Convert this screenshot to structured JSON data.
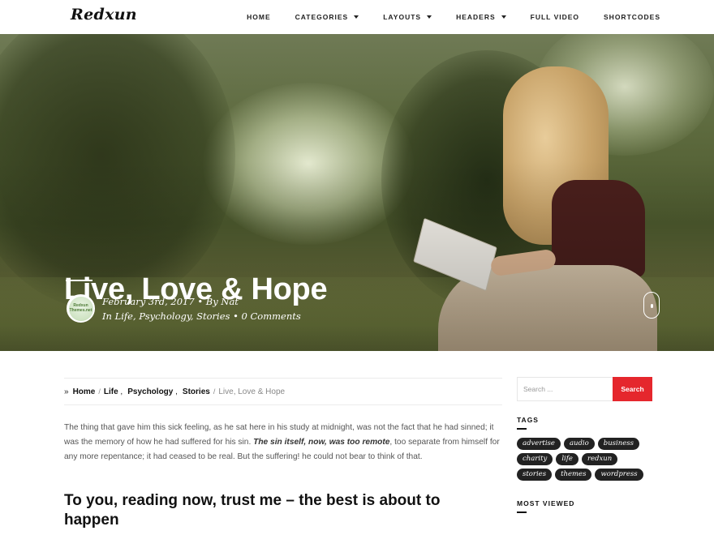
{
  "site": {
    "logo": "Redxun"
  },
  "nav": {
    "items": [
      {
        "label": "HOME",
        "dropdown": false
      },
      {
        "label": "CATEGORIES",
        "dropdown": true
      },
      {
        "label": "LAYOUTS",
        "dropdown": true
      },
      {
        "label": "HEADERS",
        "dropdown": true
      },
      {
        "label": "FULL VIDEO",
        "dropdown": false
      },
      {
        "label": "SHORTCODES",
        "dropdown": false
      }
    ]
  },
  "hero": {
    "title": "Live, Love & Hope",
    "avatar_text": "Redxun Themes.net",
    "meta_line1": "February 3rd, 2017 • By Nat",
    "meta_line2": "In Life, Psychology, Stories • 0 Comments"
  },
  "breadcrumb": {
    "home": "Home",
    "life": "Life",
    "psychology": "Psychology",
    "stories": "Stories",
    "current": "Live, Love & Hope"
  },
  "article": {
    "para_part1": "The thing that gave him this sick feeling, as he sat here in his study at midnight, was not the fact that he had sinned; it was the memory of how he had suffered for his sin. ",
    "para_em": "The sin itself, now, was too remote",
    "para_part2": ", too separate from himself for any more repentance; it had ceased to be real. But the suffering! he could not bear to think of that.",
    "heading": "To you, reading now, trust me – the best is about to happen"
  },
  "sidebar": {
    "search_placeholder": "Search ...",
    "search_button": "Search",
    "tags_title": "TAGS",
    "tags": [
      "advertise",
      "audio",
      "business",
      "charity",
      "life",
      "redxun",
      "stories",
      "themes",
      "wordpress"
    ],
    "most_viewed_title": "MOST VIEWED"
  },
  "colors": {
    "accent": "#e5272d",
    "tag_bg": "#222222"
  }
}
